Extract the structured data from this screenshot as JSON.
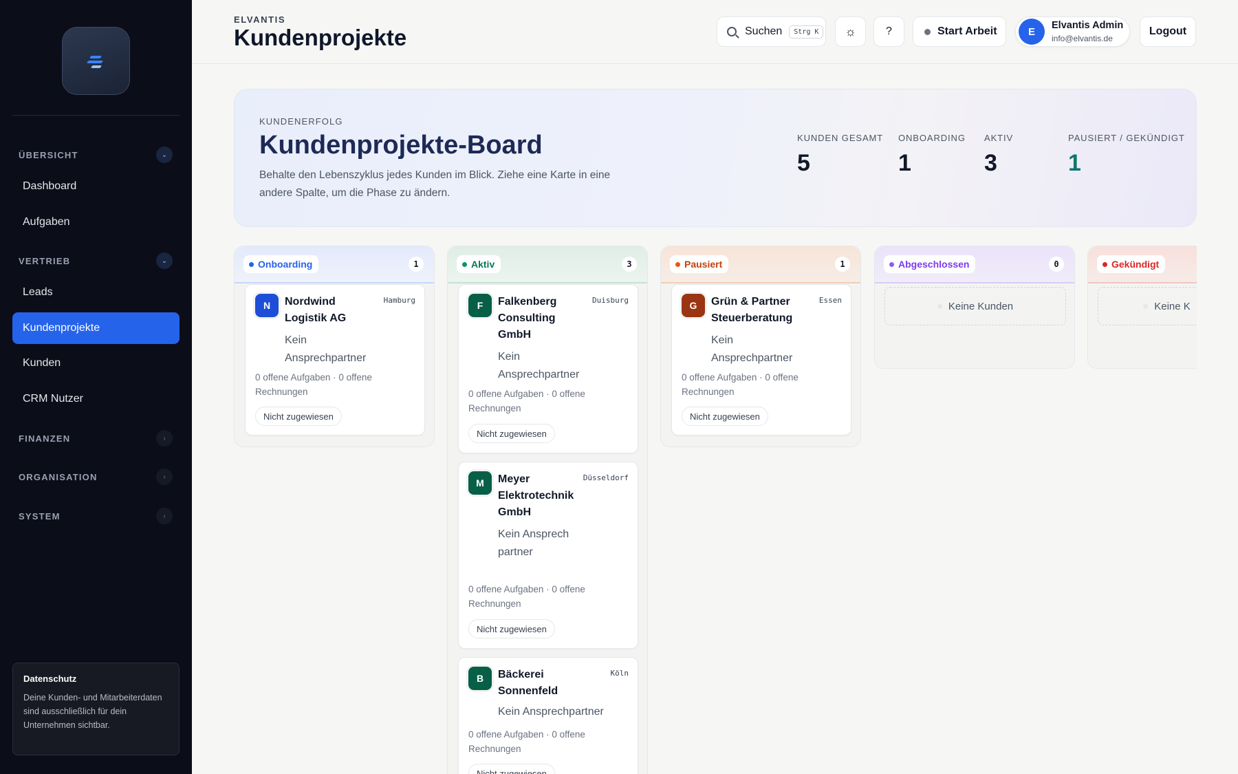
{
  "sidebar": {
    "sections": [
      {
        "label": "ÜBERSICHT",
        "expanded": true
      },
      {
        "label": "VERTRIEB",
        "expanded": true
      },
      {
        "label": "FINANZEN",
        "expanded": false
      },
      {
        "label": "ORGANISATION",
        "expanded": false
      },
      {
        "label": "SYSTEM",
        "expanded": false
      }
    ],
    "items": [
      "Dashboard",
      "Aufgaben",
      "Leads",
      "Kundenprojekte",
      "Kunden",
      "CRM Nutzer"
    ],
    "active_item": "Kundenprojekte",
    "privacy": {
      "title": "Datenschutz",
      "text": "Deine Kunden- und Mitarbeiterdaten sind ausschließlich für dein Unternehmen sichtbar."
    }
  },
  "header": {
    "brand": "ELVANTIS",
    "title": "Kundenprojekte",
    "search_label": "Suchen",
    "search_shortcut": "Strg K",
    "help_label": "?",
    "start_label": "Start Arbeit",
    "user_initial": "E",
    "user_name": "Elvantis Admin",
    "user_email": "info@elvantis.de",
    "logout_label": "Logout"
  },
  "hero": {
    "eyebrow": "KUNDENERFOLG",
    "title": "Kundenprojekte-Board",
    "subtitle": "Behalte den Lebenszyklus jedes Kunden im Blick. Ziehe eine Karte in eine andere Spalte, um die Phase zu ändern.",
    "stats": [
      {
        "label": "KUNDEN GESAMT",
        "value": "5"
      },
      {
        "label": "ONBOARDING",
        "value": "1"
      },
      {
        "label": "AKTIV",
        "value": "3"
      },
      {
        "label": "PAUSIERT / GEKÜNDIGT",
        "value": "1"
      }
    ]
  },
  "board": {
    "columns": [
      {
        "label": "Onboarding",
        "count": "1",
        "color": "#2563eb"
      },
      {
        "label": "Aktiv",
        "count": "3",
        "color": "#047857"
      },
      {
        "label": "Pausiert",
        "count": "1",
        "color": "#c2410c"
      },
      {
        "label": "Abgeschlossen",
        "count": "0",
        "color": "#7c3aed"
      },
      {
        "label": "Gekündigt",
        "count": "",
        "color": "#dc2626"
      }
    ],
    "empty_label": "Keine Kunden",
    "empty_label_cut": "Keine K",
    "cards": [
      {
        "initial": "N",
        "name": "Nordwind Logistik AG",
        "city": "Hamburg",
        "contact": "Kein Ansprechpartner",
        "meta": "0 offene Aufgaben · 0 offene Rechnungen",
        "tag": "Nicht zugewiesen",
        "color": "#1d4ed8"
      },
      {
        "initial": "F",
        "name": "Falkenberg Consulting GmbH",
        "city": "Duisburg",
        "contact": "Kein Ansprechpartner",
        "meta": "0 offene Aufgaben · 0 offene Rechnungen",
        "tag": "Nicht zugewiesen",
        "color": "#065f46"
      },
      {
        "initial": "M",
        "name": "Meyer Elektrotechnik GmbH",
        "city": "Düsseldorf",
        "contact": "Kein Ansprechpartner",
        "meta": "0 offene Aufgaben · 0 offene Rechnungen",
        "tag": "Nicht zugewiesen",
        "color": "#065f46"
      },
      {
        "initial": "B",
        "name": "Bäckerei Sonnenfeld",
        "city": "Köln",
        "contact": "Kein Ansprechpartner",
        "meta": "0 offene Aufgaben · 0 offene Rechnungen",
        "tag": "Nicht zugewiesen",
        "color": "#065f46"
      },
      {
        "initial": "G",
        "name": "Grün & Partner Steuerberatung",
        "city": "Essen",
        "contact": "Kein Ansprechpartner",
        "meta": "0 offene Aufgaben · 0 offene Rechnungen",
        "tag": "Nicht zugewiesen",
        "color": "#9a3412"
      }
    ]
  }
}
